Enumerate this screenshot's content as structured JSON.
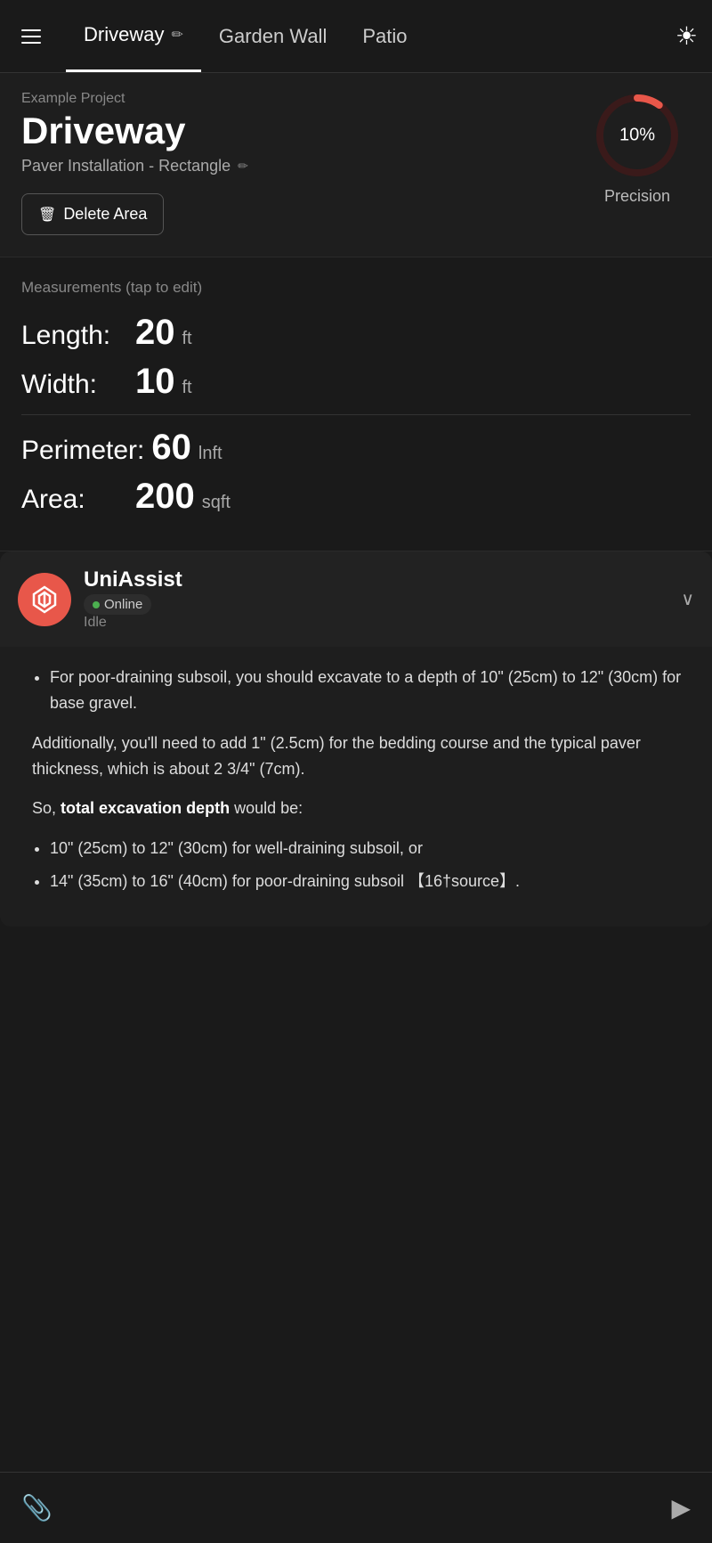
{
  "nav": {
    "tabs": [
      {
        "id": "driveway",
        "label": "Driveway",
        "active": true
      },
      {
        "id": "garden-wall",
        "label": "Garden Wall",
        "active": false
      },
      {
        "id": "patio",
        "label": "Patio",
        "active": false
      }
    ],
    "sun_icon": "☀"
  },
  "project": {
    "example_label": "Example Project",
    "title": "Driveway",
    "subtitle": "Paver Installation - Rectangle",
    "delete_btn_label": "Delete Area",
    "precision_percent": "10%",
    "precision_label": "Precision"
  },
  "measurements": {
    "section_title": "Measurements (tap to edit)",
    "length_label": "Length:",
    "length_value": "20",
    "length_unit": "ft",
    "width_label": "Width:",
    "width_value": "10",
    "width_unit": "ft",
    "perimeter_label": "Perimeter:",
    "perimeter_value": "60",
    "perimeter_unit": "lnft",
    "area_label": "Area:",
    "area_value": "200",
    "area_unit": "sqft"
  },
  "uniassist": {
    "name": "UniAssist",
    "status": "Online",
    "idle_label": "Idle",
    "chat": {
      "bullet1": "For poor-draining subsoil, you should excavate to a depth of 10\" (25cm) to 12\" (30cm) for base gravel.",
      "para1": "Additionally, you'll need to add 1\" (2.5cm) for the bedding course and the typical paver thickness, which is about 2 3/4\" (7cm).",
      "para2": "So, total excavation depth would be:",
      "bullet2": "10\" (25cm) to 12\" (30cm) for well-draining subsoil, or",
      "bullet3": "14\" (35cm) to 16\" (40cm) for poor-draining subsoil 【16†source】.",
      "bold_text": "total excavation depth"
    }
  },
  "input_bar": {
    "attach_icon": "🖇",
    "send_icon": "➤"
  }
}
